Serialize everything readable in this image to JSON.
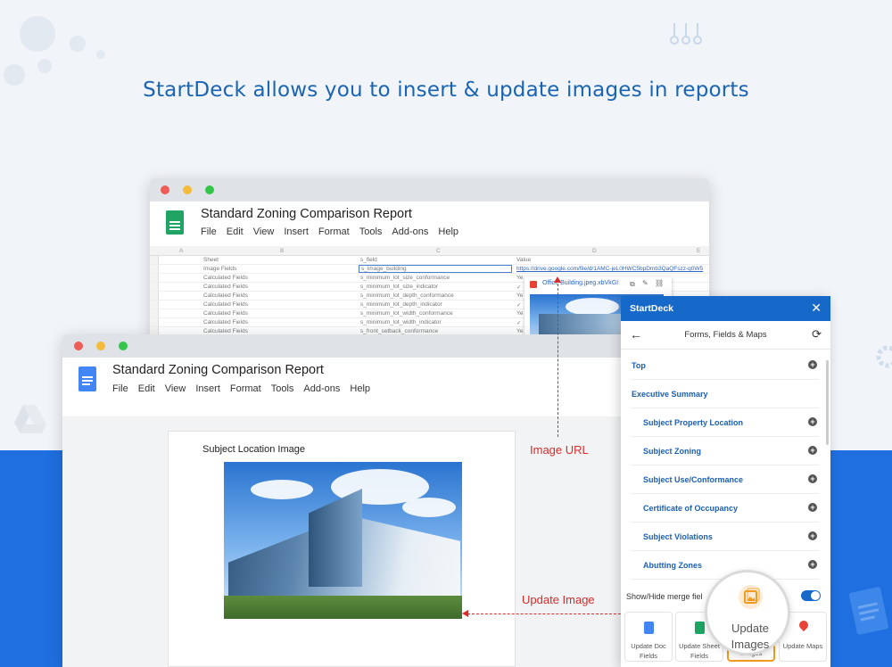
{
  "headline": "StartDeck allows you to insert & update images in reports",
  "sheets": {
    "title": "Standard Zoning Comparison Report",
    "menu": [
      "File",
      "Edit",
      "View",
      "Insert",
      "Format",
      "Tools",
      "Add-ons",
      "Help"
    ],
    "column_letters": [
      "A",
      "B",
      "C",
      "D",
      "E"
    ],
    "headers": [
      "Sheet",
      "s_field",
      "Value"
    ],
    "rows": [
      [
        "Image Fields",
        "s_image_building",
        "https://drive.google.com/file/d/1AMC-jeL0HWC5bpDmb3QaQFszz-q0W5"
      ],
      [
        "Calculated Fields",
        "s_minimum_lot_size_conformance",
        "Ye"
      ],
      [
        "Calculated Fields",
        "s_minimum_lot_size_indicator",
        "✓"
      ],
      [
        "Calculated Fields",
        "s_minimum_lot_depth_conformance",
        "Ye"
      ],
      [
        "Calculated Fields",
        "s_minimum_lot_depth_indicator",
        "✓"
      ],
      [
        "Calculated Fields",
        "s_minimum_lot_width_conformance",
        "Ye"
      ],
      [
        "Calculated Fields",
        "s_minimum_lot_width_indicator",
        "✓"
      ],
      [
        "Calculated Fields",
        "s_front_setback_conformance",
        "Ye"
      ]
    ],
    "link_chip": "Office Building.jpeg.xbVkGI"
  },
  "docs": {
    "title": "Standard Zoning Comparison Report",
    "menu": [
      "File",
      "Edit",
      "View",
      "Insert",
      "Format",
      "Tools",
      "Add-ons",
      "Help"
    ],
    "image_caption": "Subject Location Image"
  },
  "callouts": {
    "image_url": "Image URL",
    "update_image": "Update Image"
  },
  "panel": {
    "title": "StartDeck",
    "subtitle": "Forms, Fields & Maps",
    "items": [
      {
        "label": "Top",
        "indent": false
      },
      {
        "label": "Executive Summary",
        "indent": false
      },
      {
        "label": "Subject Property Location",
        "indent": true
      },
      {
        "label": "Subject Zoning",
        "indent": true
      },
      {
        "label": "Subject Use/Conformance",
        "indent": true
      },
      {
        "label": "Certificate of Occupancy",
        "indent": true
      },
      {
        "label": "Subject Violations",
        "indent": true
      },
      {
        "label": "Abutting Zones",
        "indent": true
      }
    ],
    "toggle_label": "Show/Hide merge fiel",
    "tiles": [
      {
        "label": "Update Doc Fields",
        "color": "#4285f4"
      },
      {
        "label": "Update Sheet Fields",
        "color": "#1fa463"
      },
      {
        "label": "Images",
        "color": "#f29a1e"
      },
      {
        "label": "Update Maps",
        "color": "#ea4335"
      }
    ],
    "magnifier_label": "Update Images"
  },
  "colors": {
    "accent_blue": "#1769c9",
    "callout_red": "#d92c2c",
    "headline_blue": "#1a64b4"
  }
}
